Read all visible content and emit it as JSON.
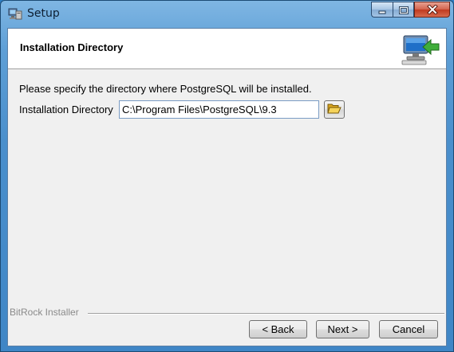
{
  "window": {
    "title": "Setup",
    "app_icon": "setup-computer-icon"
  },
  "caption_buttons": {
    "minimize_icon": "minimize-icon",
    "maximize_icon": "maximize-icon",
    "close_icon": "close-icon"
  },
  "header": {
    "title": "Installation Directory",
    "icon": "computer-arrow-icon"
  },
  "main": {
    "instruction": "Please specify the directory where PostgreSQL will be installed.",
    "directory_label": "Installation Directory",
    "directory_value": "C:\\Program Files\\PostgreSQL\\9.3",
    "browse_icon": "folder-open-icon"
  },
  "footer": {
    "brand": "BitRock Installer",
    "back_label": "< Back",
    "next_label": "Next >",
    "cancel_label": "Cancel"
  }
}
